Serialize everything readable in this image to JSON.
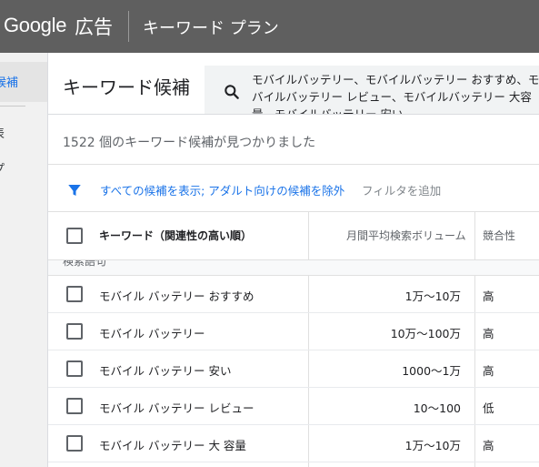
{
  "app": {
    "logo": "Google",
    "logo_sub": "広告",
    "page": "キーワード プラン"
  },
  "sidebar": {
    "active_item": "候補",
    "items": [
      "表",
      "プ"
    ]
  },
  "main": {
    "title": "キーワード候補",
    "search_value": "モバイルバッテリー、モバイルバッテリー おすすめ、モバイルバッテリー レビュー、モバイルバッテリー 大容量、モバイルバッテリー 安い",
    "count_text": "1522 個のキーワード候補が見つかりました",
    "filter_link": "すべての候補を表示; アダルト向けの候補を除外",
    "filter_add": "フィルタを追加"
  },
  "table": {
    "headers": {
      "keyword": "キーワード（関連性の高い順）",
      "volume": "月間平均検索ボリューム",
      "competition": "競合性"
    },
    "group_label": "検索語句",
    "rows": [
      {
        "keyword": "モバイル バッテリー おすすめ",
        "volume": "1万～10万",
        "competition": "高"
      },
      {
        "keyword": "モバイル バッテリー",
        "volume": "10万～100万",
        "competition": "高"
      },
      {
        "keyword": "モバイル バッテリー 安い",
        "volume": "1000～1万",
        "competition": "高"
      },
      {
        "keyword": "モバイル バッテリー レビュー",
        "volume": "10～100",
        "competition": "低"
      },
      {
        "keyword": "モバイル バッテリー 大 容量",
        "volume": "1万～10万",
        "competition": "高"
      }
    ]
  },
  "icons": {
    "search": "search-icon",
    "filter": "filter-icon"
  },
  "colors": {
    "topbar": "#5f5f5f",
    "link": "#1a73e8",
    "filter_icon": "#1a73e8"
  }
}
